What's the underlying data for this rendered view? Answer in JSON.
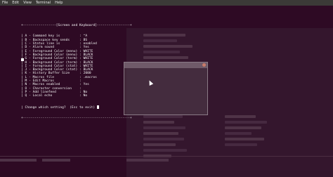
{
  "menu": {
    "file": "File",
    "edit": "Edit",
    "view": "View",
    "terminal": "Terminal",
    "help": "Help"
  },
  "setup": {
    "header": "+-----------------[Screen and Keyboard]-----------------+",
    "rows": [
      {
        "key": "A",
        "label": "Command key is",
        "value": "^A"
      },
      {
        "key": "B",
        "label": "Backspace key sends",
        "value": "BS"
      },
      {
        "key": "C",
        "label": "Status line is",
        "value": "enabled"
      },
      {
        "key": "D",
        "label": "Alarm sound",
        "value": "Yes"
      },
      {
        "key": "E",
        "label": "Foreground Color (menu)",
        "value": "WHITE"
      },
      {
        "key": "F",
        "label": "Background Color (menu)",
        "value": "BLACK"
      },
      {
        "key": "G",
        "label": "Foreground Color (term)",
        "value": "WHITE"
      },
      {
        "key": "H",
        "label": "Background Color (term)",
        "value": "BLACK"
      },
      {
        "key": "I",
        "label": "Foreground Color (stat)",
        "value": "WHITE"
      },
      {
        "key": "J",
        "label": "Background Color (stat)",
        "value": "BLACK"
      },
      {
        "key": "K",
        "label": "History Buffer Size",
        "value": "2000"
      },
      {
        "key": "L",
        "label": "Macros file",
        "value": ".macros"
      },
      {
        "key": "M",
        "label": "Edit Macros",
        "value": ""
      },
      {
        "key": "N",
        "label": "Macros enabled",
        "value": "Yes"
      },
      {
        "key": "O",
        "label": "Character conversion",
        "value": ""
      },
      {
        "key": "P",
        "label": "Add linefeed",
        "value": "No"
      },
      {
        "key": "Q",
        "label": "Local echo",
        "value": "No"
      }
    ],
    "prompt": "Change which setting?  (Esc to exit)",
    "footer": "+-------------------------------------------------------+"
  }
}
